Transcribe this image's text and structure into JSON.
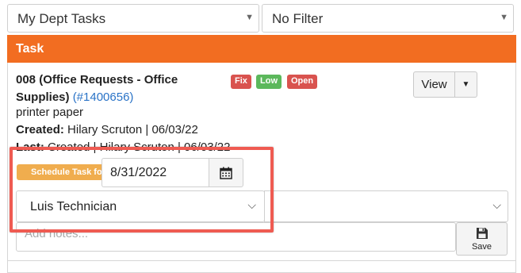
{
  "filters": {
    "dept_select": "My Dept Tasks",
    "filter_select": "No Filter"
  },
  "panel": {
    "header": "Task"
  },
  "task": {
    "title": "008 (Office Requests - Office Supplies)",
    "link": "(#1400656)",
    "description": "printer paper",
    "created_label": "Created:",
    "created_value": "Hilary Scruton | 06/03/22",
    "last_label": "Last:",
    "last_value": "Created | Hilary Scruton | 06/03/22",
    "badges": [
      {
        "label": "Fix",
        "color": "#d9534f"
      },
      {
        "label": "Low",
        "color": "#5cb85c"
      },
      {
        "label": "Open",
        "color": "#d9534f"
      }
    ],
    "view_label": "View"
  },
  "schedule": {
    "label": "Schedule Task for",
    "date": "8/31/2022",
    "technician": "Luis Technician"
  },
  "notes": {
    "placeholder": "Add notes...",
    "save_label": "Save"
  },
  "colors": {
    "header": "#f26d21",
    "schedule_label": "#f0ad4e",
    "highlight": "#ef5b52",
    "link": "#2a73c7"
  },
  "icons": {
    "calendar": "calendar-icon",
    "save": "floppy-save-icon",
    "view_caret": "caret-down-icon",
    "select_chevron": "chevron-down-icon"
  }
}
